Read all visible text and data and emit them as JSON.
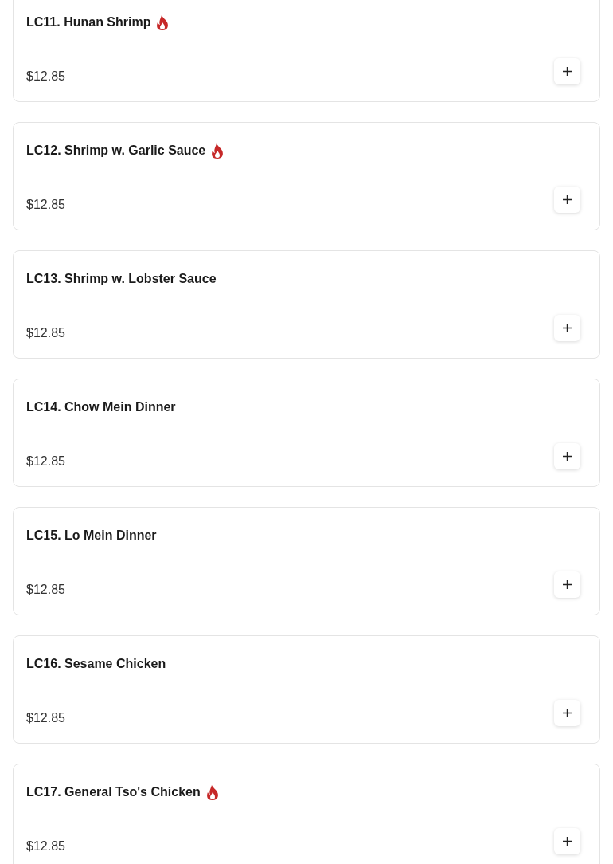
{
  "menu_items": [
    {
      "name": "LC11. Hunan Shrimp",
      "spicy": true,
      "price": "$12.85"
    },
    {
      "name": "LC12. Shrimp w. Garlic Sauce",
      "spicy": true,
      "price": "$12.85"
    },
    {
      "name": "LC13. Shrimp w. Lobster Sauce",
      "spicy": false,
      "price": "$12.85"
    },
    {
      "name": "LC14. Chow Mein Dinner",
      "spicy": false,
      "price": "$12.85"
    },
    {
      "name": "LC15. Lo Mein Dinner",
      "spicy": false,
      "price": "$12.85"
    },
    {
      "name": "LC16. Sesame Chicken",
      "spicy": false,
      "price": "$12.85"
    },
    {
      "name": "LC17. General Tso's Chicken",
      "spicy": true,
      "price": "$12.85"
    }
  ]
}
